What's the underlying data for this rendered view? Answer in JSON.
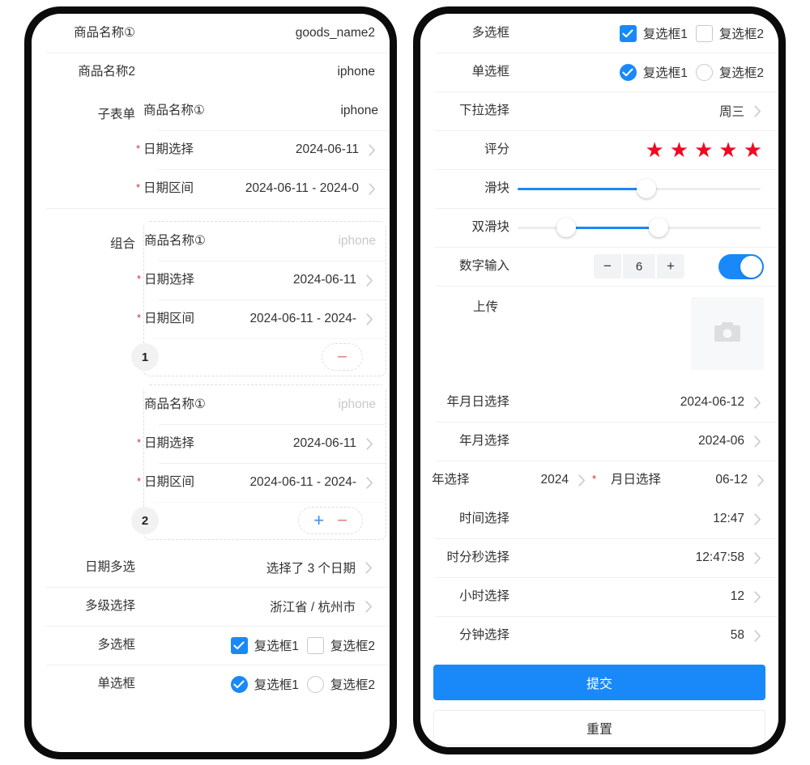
{
  "theme": {
    "accent": "#1989fa",
    "required_star": "#c63535",
    "star_color": "#ee0a24",
    "placeholder": "#c8c9cc",
    "text": "#323233"
  },
  "left_phone": {
    "rows": [
      {
        "label": "商品名称",
        "info": "①",
        "required": false,
        "value": "goods_name2",
        "chevron": false
      },
      {
        "label": "商品名称2",
        "required": true,
        "value": "iphone",
        "chevron": false
      }
    ],
    "subform": {
      "label": "子表单",
      "rows": [
        {
          "label": "商品名称",
          "info": "①",
          "required": false,
          "value": "iphone",
          "chevron": false
        },
        {
          "label": "日期选择",
          "required": true,
          "value": "2024-06-11",
          "chevron": true
        },
        {
          "label": "日期区间",
          "required": true,
          "value": "2024-06-11 - 2024-0",
          "chevron": true
        }
      ]
    },
    "combo": {
      "label": "组合",
      "cards": [
        {
          "index": "1",
          "ops": [
            "minus"
          ],
          "rows": [
            {
              "label": "商品名称",
              "info": "①",
              "required": false,
              "value": "iphone",
              "placeholder": true,
              "chevron": false
            },
            {
              "label": "日期选择",
              "required": true,
              "value": "2024-06-11",
              "chevron": true
            },
            {
              "label": "日期区间",
              "required": true,
              "value": "2024-06-11 - 2024-",
              "chevron": true
            }
          ]
        },
        {
          "index": "2",
          "ops": [
            "plus",
            "minus"
          ],
          "rows": [
            {
              "label": "商品名称",
              "info": "①",
              "required": false,
              "value": "iphone",
              "placeholder": true,
              "chevron": false
            },
            {
              "label": "日期选择",
              "required": true,
              "value": "2024-06-11",
              "chevron": true
            },
            {
              "label": "日期区间",
              "required": true,
              "value": "2024-06-11 - 2024-",
              "chevron": true
            }
          ]
        }
      ],
      "op_symbols": {
        "plus": "+",
        "minus": "−"
      }
    },
    "tail_rows": [
      {
        "label": "日期多选",
        "required": false,
        "value": "选择了 3 个日期",
        "chevron": true
      },
      {
        "label": "多级选择",
        "required": true,
        "value": "浙江省 / 杭州市",
        "chevron": true
      }
    ],
    "checkbox_row": {
      "label": "多选框",
      "required": true,
      "options": [
        {
          "text": "复选框1",
          "checked": true
        },
        {
          "text": "复选框2",
          "checked": false
        }
      ]
    },
    "radio_row": {
      "label": "单选框",
      "required": true,
      "options": [
        {
          "text": "复选框1",
          "checked": true
        },
        {
          "text": "复选框2",
          "checked": false
        }
      ]
    }
  },
  "right_phone": {
    "checkbox_row": {
      "label": "多选框",
      "required": true,
      "options": [
        {
          "text": "复选框1",
          "checked": true
        },
        {
          "text": "复选框2",
          "checked": false
        }
      ]
    },
    "radio_row": {
      "label": "单选框",
      "required": true,
      "options": [
        {
          "text": "复选框1",
          "checked": true
        },
        {
          "text": "复选框2",
          "checked": false
        }
      ]
    },
    "select_row": {
      "label": "下拉选择",
      "required": true,
      "value": "周三",
      "chevron": true
    },
    "rate_row": {
      "label": "评分",
      "required": true,
      "stars_total": 5,
      "stars_filled": 5,
      "glyph": "★"
    },
    "slider_row": {
      "label": "滑块",
      "required": true,
      "value_percent": 53
    },
    "range_row": {
      "label": "双滑块",
      "required": true,
      "start_percent": 20,
      "end_percent": 58
    },
    "stepper_row": {
      "label": "数字输入",
      "required": true,
      "minus": "−",
      "plus": "+",
      "value": "6",
      "switch_on": true
    },
    "upload_row": {
      "label": "上传",
      "required": true,
      "icon": "camera-icon"
    },
    "date_rows": [
      {
        "label": "年月日选择",
        "required": true,
        "value": "2024-06-12",
        "chevron": true
      },
      {
        "label": "年月选择",
        "required": true,
        "value": "2024-06",
        "chevron": true
      }
    ],
    "split_row": {
      "left": {
        "label": "年选择",
        "required": true,
        "value": "2024",
        "chevron": true
      },
      "right": {
        "label": "月日选择",
        "required": true,
        "value": "06-12",
        "chevron": true
      }
    },
    "time_rows": [
      {
        "label": "时间选择",
        "required": true,
        "value": "12:47",
        "chevron": true
      },
      {
        "label": "时分秒选择",
        "required": true,
        "value": "12:47:58",
        "chevron": true
      },
      {
        "label": "小时选择",
        "required": true,
        "value": "12",
        "chevron": true
      },
      {
        "label": "分钟选择",
        "required": false,
        "value": "58",
        "chevron": true
      }
    ],
    "actions": {
      "submit_label": "提交",
      "reset_label": "重置"
    }
  }
}
